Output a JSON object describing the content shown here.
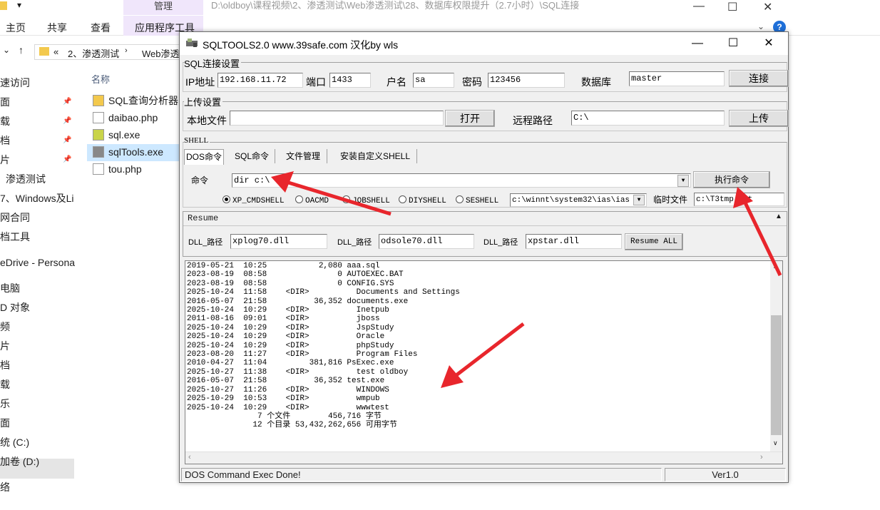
{
  "explorer": {
    "title_path": "D:\\oldboy\\课程视频\\2、渗透测试\\Web渗透测试\\28、数据库权限提升（2.7小时）\\SQL连接",
    "ribbon_tabs": [
      "主页",
      "共享",
      "查看"
    ],
    "ribbon_manage": "管理",
    "ribbon_apptools": "应用程序工具",
    "breadcrumb": [
      "«",
      "2、渗透测试",
      "Web渗透"
    ],
    "column_name": "名称",
    "nav_items": [
      "速访问",
      "面",
      "载",
      "档",
      "片",
      "渗透测试",
      "7、Windows及Li",
      "网合同",
      "档工具",
      "eDrive - Persona",
      "电脑",
      "D 对象",
      "频",
      "片",
      "档",
      "载",
      "乐",
      "面",
      "统 (C:)",
      "加卷 (D:)",
      "络"
    ],
    "files": [
      "SQL查询分析器",
      "daibao.php",
      "sql.exe",
      "sqlTools.exe",
      "tou.php"
    ],
    "help": "?"
  },
  "sqltools": {
    "title": "SQLTOOLS2.0 www.39safe.com 汉化by wls",
    "conn_group": "SQL连接设置",
    "ip_label": "IP地址",
    "ip_value": "192.168.11.72",
    "port_label": "端口",
    "port_value": "1433",
    "user_label": "户名",
    "user_value": "sa",
    "pass_label": "密码",
    "pass_value": "123456",
    "db_label": "数据库",
    "db_value": "master",
    "connect_btn": "连接",
    "upload_group": "上传设置",
    "local_label": "本地文件",
    "local_value": "",
    "open_btn": "打开",
    "remote_label": "远程路径",
    "remote_value": "C:\\",
    "upload_btn": "上传",
    "shell_group": "SHELL",
    "tabs": [
      "DOS命令",
      "SQL命令",
      "文件管理",
      "安装自定义SHELL"
    ],
    "cmd_label": "命令",
    "cmd_value": "dir c:\\",
    "exec_btn": "执行命令",
    "radios": [
      "XP_CMDSHELL",
      "OACMD",
      "JOBSHELL",
      "DIYSHELL",
      "SESHELL"
    ],
    "shell_path": "c:\\winnt\\system32\\ias\\ias",
    "temp_label": "临时文件",
    "temp_value": "c:\\T3tmp.txt",
    "resume_label": "Resume",
    "dll1_label": "DLL_路径",
    "dll1_value": "xplog70.dll",
    "dll2_label": "DLL_路径",
    "dll2_value": "odsole70.dll",
    "dll3_label": "DLL_路径",
    "dll3_value": "xpstar.dll",
    "resume_btn": "Resume ALL",
    "output": "2019-05-21  10:25           2,080 aaa.sql\n2023-08-19  08:58               0 AUTOEXEC.BAT\n2023-08-19  08:58               0 CONFIG.SYS\n2025-10-24  11:58    <DIR>          Documents and Settings\n2016-05-07  21:58          36,352 documents.exe\n2025-10-24  10:29    <DIR>          Inetpub\n2011-08-16  09:01    <DIR>          jboss\n2025-10-24  10:29    <DIR>          JspStudy\n2025-10-24  10:29    <DIR>          Oracle\n2025-10-24  10:29    <DIR>          phpStudy\n2023-08-20  11:27    <DIR>          Program Files\n2010-04-27  11:04         381,816 PsExec.exe\n2025-10-27  11:38    <DIR>          test oldboy\n2016-05-07  21:58          36,352 test.exe\n2025-10-27  11:26    <DIR>          WINDOWS\n2025-10-29  10:53    <DIR>          wmpub\n2025-10-24  10:29    <DIR>          wwwtest\n               7 个文件        456,716 字节\n              12 个目录 53,432,262,656 可用字节",
    "status": "DOS Command Exec Done!",
    "version": "Ver1.0"
  },
  "colors": {
    "arrow": "#e8262c",
    "manage_tab": "#f0e6fb",
    "selection": "#cde8ff"
  }
}
